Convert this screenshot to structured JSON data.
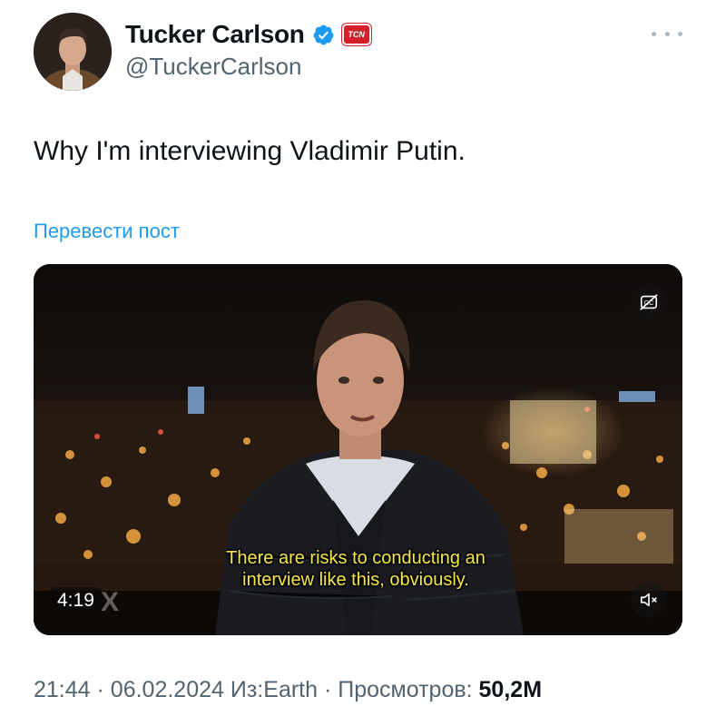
{
  "author": {
    "display_name": "Tucker Carlson",
    "handle": "@TuckerCarlson",
    "affiliate_badge_text": "TCN",
    "verified_icon": "verified-badge-icon",
    "avatar_icon": "profile-photo"
  },
  "more_icon": "more-options-icon",
  "tweet": {
    "text": "Why I'm interviewing Vladimir Putin.",
    "translate_label": "Перевести пост"
  },
  "video": {
    "subtitle": "There are risks to conducting an interview like this, obviously.",
    "duration": "4:19",
    "watermark": "X",
    "cc_icon": "closed-captions-off-icon",
    "mute_icon": "muted-volume-icon"
  },
  "meta": {
    "time": "21:44",
    "date": "06.02.2024",
    "source_prefix": "Из:",
    "source": "Earth",
    "views_label": "Просмотров:",
    "views_count": "50,2M",
    "separator": "·"
  },
  "colors": {
    "link": "#1d9bf0",
    "secondary_text": "#536471",
    "verified": "#1d9bf0",
    "badge": "#d3202a"
  }
}
